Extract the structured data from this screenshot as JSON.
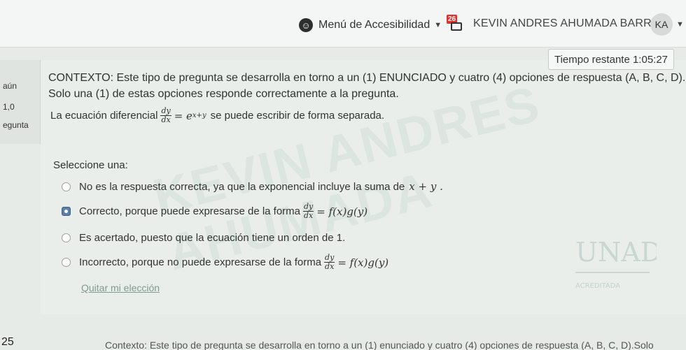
{
  "header": {
    "accessibility_menu": "Menú de Accesibilidad",
    "notification_badge": "26",
    "user_name": "KEVIN ANDRES AHUMADA BARROS",
    "avatar_initials": "KA"
  },
  "question_info": {
    "status_fragment": "aún",
    "score_fragment": "1,0",
    "label_fragment": "egunta"
  },
  "timer": "Tiempo restante 1:05:27",
  "question": {
    "context_line1": "CONTEXTO: Este tipo de pregunta se desarrolla en torno a un (1) ENUNCIADO y cuatro (4) opciones de respuesta (A, B, C, D).",
    "context_line2": "Solo una (1) de estas opciones responde correctamente a la pregunta.",
    "statement_prefix": "La ecuación diferencial",
    "statement_suffix": "se puede escribir de forma separada.",
    "eq_num": "dy",
    "eq_den": "dx",
    "eq_rhs": "= e",
    "eq_exp": "x+y",
    "select_label": "Seleccione una:",
    "options": [
      {
        "text": "No es la respuesta correcta, ya que la exponencial incluye la suma de",
        "math": "x + y .",
        "checked": false
      },
      {
        "text": "Correcto, porque puede expresarse de la forma",
        "math": "= f(x)g(y)",
        "checked": true
      },
      {
        "text": "Es acertado, puesto que la ecuación tiene un orden de 1.",
        "math": "",
        "checked": false
      },
      {
        "text": "Incorrecto, porque no puede expresarse de la forma",
        "math": "= f(x)g(y)",
        "checked": false
      }
    ],
    "clear_choice": "Quitar mi elección"
  },
  "watermark": "KEVIN ANDRES AHUMADA",
  "logo_watermark": {
    "name": "UNAD",
    "caption": "ACREDITADA"
  },
  "footer": {
    "question_number": "25",
    "context_text": "Contexto: Este tipo de pregunta se desarrolla en torno a un (1) enunciado y cuatro (4) opciones de respuesta (A, B, C, D).Solo"
  }
}
